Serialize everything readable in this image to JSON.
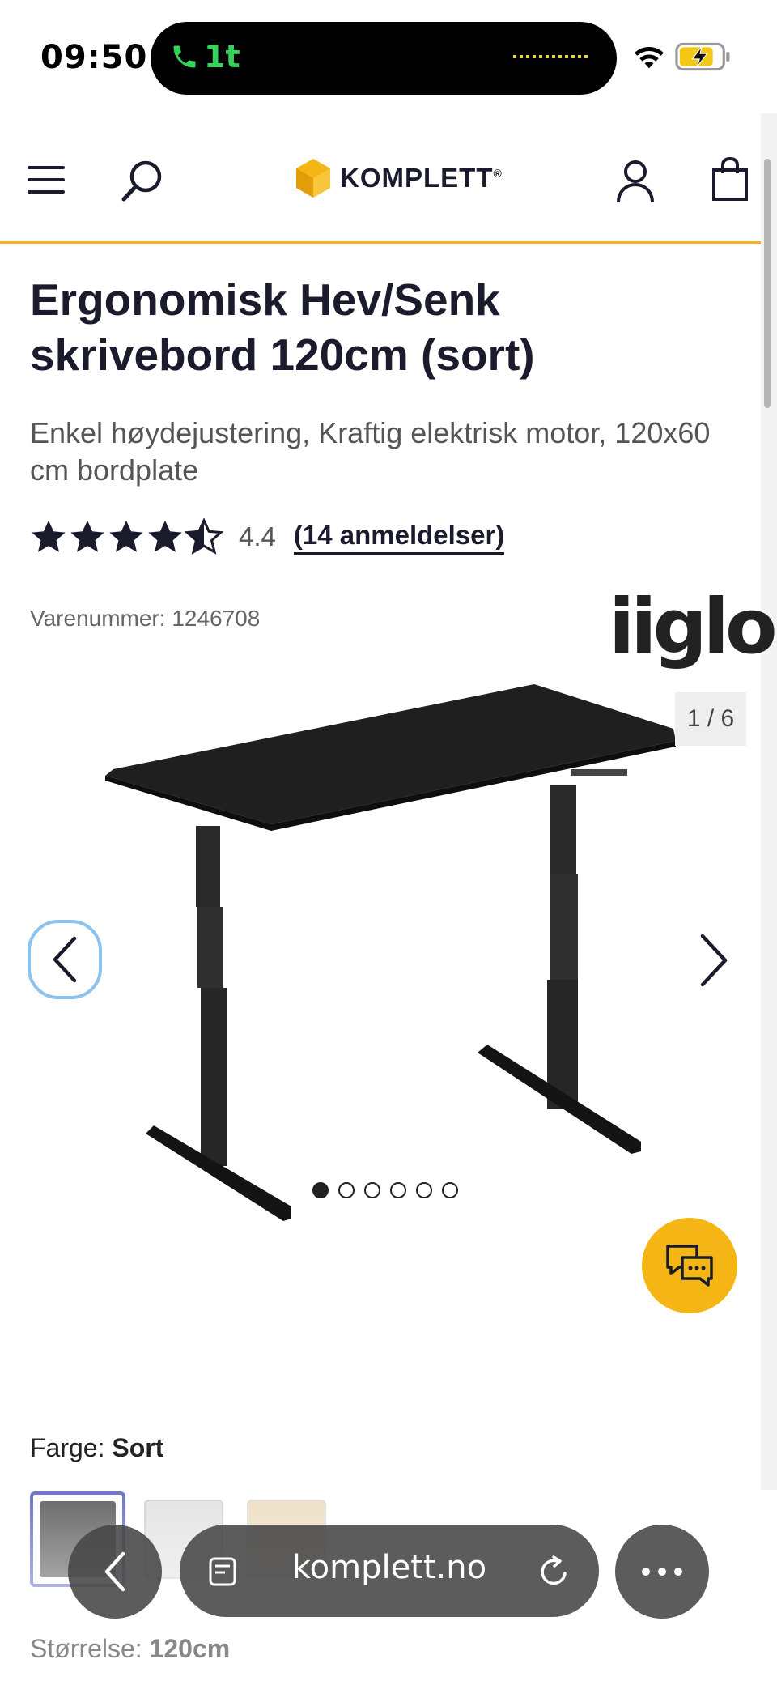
{
  "status_bar": {
    "time": "09:50",
    "call_duration": "1t"
  },
  "header": {
    "brand_name": "KOMPLETT",
    "brand_mark": "®"
  },
  "product": {
    "title": "Ergonomisk Hev/Senk skrivebord 120cm (sort)",
    "subtitle": "Enkel høydejustering, Kraftig elektrisk motor, 120x60 cm bordplate",
    "rating": 4.4,
    "rating_label": "4.4",
    "reviews_label": "(14 anmeldelser)",
    "sku_label": "Varenummer: 1246708",
    "brand_logo": "iiglo"
  },
  "gallery": {
    "counter": "1 / 6",
    "current": 1,
    "total": 6
  },
  "options": {
    "color_label": "Farge:",
    "color_value": "Sort",
    "swatches": [
      "#666666",
      "#e4e4e4",
      "#eedfc6"
    ],
    "size_label": "Størrelse:",
    "size_value": "120cm"
  },
  "browser": {
    "url": "komplett.no"
  },
  "colors": {
    "accent": "#f2b418",
    "text": "#1b1b2e",
    "call_green": "#35d35a"
  },
  "icons": [
    "phone-icon",
    "wifi-icon",
    "battery-icon",
    "menu-icon",
    "search-icon",
    "user-icon",
    "bag-icon",
    "star-icon",
    "chevron-left-icon",
    "chevron-right-icon",
    "chat-icon",
    "tabs-icon",
    "reload-icon",
    "more-icon"
  ]
}
